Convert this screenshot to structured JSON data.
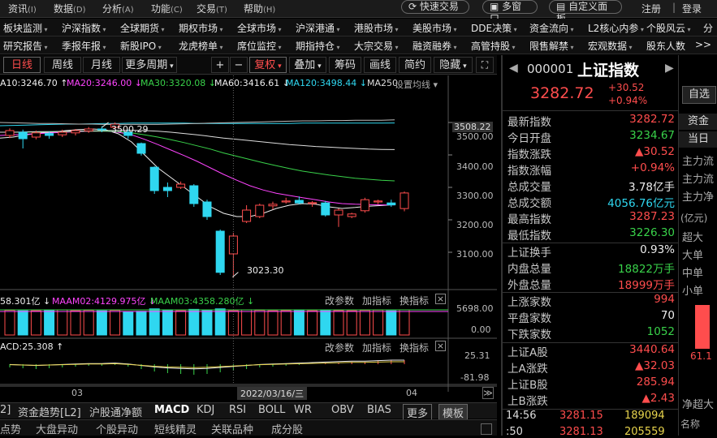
{
  "menu": [
    "资讯",
    "数据",
    "分析",
    "功能",
    "交易",
    "帮助"
  ],
  "menu_keys": [
    "(I)",
    "(D)",
    "(A)",
    "(C)",
    "(T)",
    "(H)"
  ],
  "top_pills": [
    "快速交易",
    "多窗口",
    "自定义面板"
  ],
  "top_links": [
    "注册",
    "登录"
  ],
  "nav1": [
    "板块监测",
    "沪深指数",
    "全球期货",
    "期权市场",
    "全球市场",
    "沪深港通",
    "港股市场",
    "美股市场",
    "DDE决策",
    "资金流向",
    "L2核心内参",
    "个股风云",
    "分"
  ],
  "nav2": [
    "研究报告",
    "季报年报",
    "新股IPO",
    "龙虎榜单",
    "席位监控",
    "期指持仓",
    "大宗交易",
    "融资融券",
    "高管持股",
    "限售解禁",
    "宏观数据",
    "股东人数",
    ">>"
  ],
  "toolbar": {
    "tabs": [
      "日线",
      "周线",
      "月线",
      "更多周期"
    ],
    "plus": "+",
    "minus": "−",
    "tools": [
      "复权",
      "叠加",
      "筹码",
      "画线",
      "简约",
      "隐藏"
    ]
  },
  "ma_line": {
    "ma10": "A10:3246.70 ↑",
    "ma20": "MA20:3246.00 ↓",
    "ma30": "MA30:3320.08 ↓",
    "ma60": "MA60:3416.61 ↓",
    "ma120": "MA120:3498.44 ↓",
    "ma250": "MA250",
    "setting": "设置均线"
  },
  "price_axis": [
    "3508.22",
    "3500.00",
    "3400.00",
    "3300.00",
    "3200.00",
    "3100.00"
  ],
  "annotations": {
    "high": "3500.29",
    "low": "3023.30"
  },
  "volume": {
    "label1": "58.301亿 ↓",
    "label2": "MAAM02:4129.975亿 ↓",
    "label3": "MAAM03:4358.280亿 ↓",
    "axis_top": "5698.00",
    "axis_bottom": "0.00",
    "controls": [
      "改参数",
      "加指标",
      "换指标"
    ]
  },
  "macd": {
    "label": "ACD:25.308 ↑",
    "axis_top": "25.31",
    "axis_bottom": "-81.98",
    "controls": [
      "改参数",
      "加指标",
      "换指标"
    ]
  },
  "date_axis": {
    "left": "03",
    "center": "2022/03/16/三",
    "right": "04"
  },
  "indicator_tabs": [
    "2]",
    "资金趋势[L2]",
    "沪股通净额",
    "MACD",
    "KDJ",
    "RSI",
    "BOLL",
    "WR",
    "OBV",
    "BIAS",
    "更多",
    "模板"
  ],
  "bottom_tabs": [
    "点势",
    "大盘异动",
    "个股异动",
    "短线精灵",
    "关联品种",
    "成分股"
  ],
  "quote": {
    "code": "000001",
    "name": "上证指数",
    "price": "3282.72",
    "change": "+30.52",
    "pct": "+0.94%",
    "self_select": "自选",
    "rows1": [
      {
        "k": "最新指数",
        "v": "3282.72",
        "c": "red"
      },
      {
        "k": "今日开盘",
        "v": "3234.67",
        "c": "green"
      },
      {
        "k": "指数涨跌",
        "v": "▲30.52",
        "c": "red"
      },
      {
        "k": "指数涨幅",
        "v": "+0.94%",
        "c": "red"
      },
      {
        "k": "总成交量",
        "v": "3.78亿手",
        "c": "white"
      },
      {
        "k": "总成交额",
        "v": "4056.76亿元",
        "c": "cyan"
      },
      {
        "k": "最高指数",
        "v": "3287.23",
        "c": "red"
      },
      {
        "k": "最低指数",
        "v": "3226.30",
        "c": "green"
      }
    ],
    "rows2": [
      {
        "k": "上证换手",
        "v": "0.93%",
        "c": "white"
      },
      {
        "k": "内盘总量",
        "v": "18822万手",
        "c": "green"
      },
      {
        "k": "外盘总量",
        "v": "18999万手",
        "c": "red"
      }
    ],
    "rows3": [
      {
        "k": "上涨家数",
        "v": "994",
        "c": "red"
      },
      {
        "k": "平盘家数",
        "v": "70",
        "c": "white"
      },
      {
        "k": "下跌家数",
        "v": "1052",
        "c": "green"
      }
    ],
    "rows4": [
      {
        "k": "上证A股",
        "v": "3440.64",
        "c": "red"
      },
      {
        "k": "上A涨跌",
        "v": "▲32.03",
        "c": "red"
      },
      {
        "k": "上证B股",
        "v": "285.94",
        "c": "red"
      },
      {
        "k": "上B涨跌",
        "v": "▲2.43",
        "c": "red"
      }
    ],
    "ticks": [
      {
        "t": "14:56",
        "p": "3281.15",
        "v": "189094"
      },
      {
        "t": ":50",
        "p": "3281.13",
        "v": "205559"
      }
    ]
  },
  "side_panel": {
    "tabs": [
      "资金",
      "当日"
    ],
    "flows": [
      "主力流",
      "主力流",
      "主力净"
    ],
    "unit": "(亿元)",
    "sizes": [
      "超大",
      "大单",
      "中单",
      "小单"
    ],
    "bar_value": "61.1",
    "net": "净超大",
    "name_col": "名称"
  },
  "chart_data": {
    "type": "candlestick",
    "ylim": [
      3000,
      3520
    ],
    "candles": [
      {
        "o": 3460,
        "c": 3475,
        "h": 3482,
        "l": 3452
      },
      {
        "o": 3470,
        "c": 3450,
        "h": 3478,
        "l": 3420
      },
      {
        "o": 3455,
        "c": 3468,
        "h": 3475,
        "l": 3448
      },
      {
        "o": 3466,
        "c": 3460,
        "h": 3472,
        "l": 3450
      },
      {
        "o": 3462,
        "c": 3470,
        "h": 3478,
        "l": 3455
      },
      {
        "o": 3468,
        "c": 3475,
        "h": 3480,
        "l": 3460
      },
      {
        "o": 3474,
        "c": 3480,
        "h": 3486,
        "l": 3468
      },
      {
        "o": 3480,
        "c": 3478,
        "h": 3488,
        "l": 3470
      },
      {
        "o": 3485,
        "c": 3495,
        "h": 3500.29,
        "l": 3480
      },
      {
        "o": 3470,
        "c": 3460,
        "h": 3478,
        "l": 3450
      },
      {
        "o": 3435,
        "c": 3405,
        "h": 3438,
        "l": 3398
      },
      {
        "o": 3362,
        "c": 3290,
        "h": 3365,
        "l": 3280
      },
      {
        "o": 3300,
        "c": 3290,
        "h": 3315,
        "l": 3270
      },
      {
        "o": 3300,
        "c": 3310,
        "h": 3318,
        "l": 3295
      },
      {
        "o": 3305,
        "c": 3250,
        "h": 3310,
        "l": 3240
      },
      {
        "o": 3255,
        "c": 3210,
        "h": 3262,
        "l": 3200
      },
      {
        "o": 3165,
        "c": 3038,
        "h": 3170,
        "l": 3030
      },
      {
        "o": 3095,
        "c": 3150,
        "h": 3160,
        "l": 3023.3
      },
      {
        "o": 3195,
        "c": 3230,
        "h": 3245,
        "l": 3190
      },
      {
        "o": 3210,
        "c": 3245,
        "h": 3250,
        "l": 3205
      },
      {
        "o": 3243,
        "c": 3248,
        "h": 3256,
        "l": 3232
      },
      {
        "o": 3255,
        "c": 3258,
        "h": 3268,
        "l": 3250
      },
      {
        "o": 3260,
        "c": 3252,
        "h": 3272,
        "l": 3248
      },
      {
        "o": 3250,
        "c": 3253,
        "h": 3258,
        "l": 3240
      },
      {
        "o": 3252,
        "c": 3215,
        "h": 3258,
        "l": 3210
      },
      {
        "o": 3215,
        "c": 3230,
        "h": 3235,
        "l": 3178
      },
      {
        "o": 3210,
        "c": 3218,
        "h": 3222,
        "l": 3205
      },
      {
        "o": 3228,
        "c": 3262,
        "h": 3268,
        "l": 3222
      },
      {
        "o": 3255,
        "c": 3258,
        "h": 3262,
        "l": 3248
      },
      {
        "o": 3252,
        "c": 3246,
        "h": 3262,
        "l": 3240
      },
      {
        "o": 3234.67,
        "c": 3282.72,
        "h": 3287.23,
        "l": 3226.3
      }
    ],
    "volume": [
      5100,
      5000,
      5000,
      5100,
      5200,
      5000,
      5100,
      5000,
      5100,
      4800,
      4900,
      5400,
      5200,
      5000,
      5300,
      5100,
      5400,
      5000,
      5200,
      5100,
      5000,
      5050,
      5100,
      5000,
      5100,
      5050,
      5000,
      5100,
      5150,
      5000,
      5200
    ],
    "vol_ylim": [
      0,
      5698
    ],
    "macd_ylim": [
      -81.98,
      25.31
    ]
  }
}
